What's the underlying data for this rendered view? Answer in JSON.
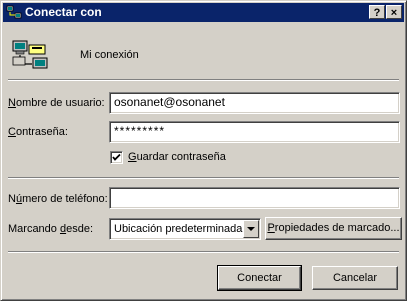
{
  "window": {
    "title": "Conectar con",
    "help_label": "?",
    "close_label": "×"
  },
  "connection": {
    "name": "Mi conexión"
  },
  "form": {
    "username": {
      "label_before": "",
      "label_access": "N",
      "label_after": "ombre de usuario:",
      "value": "osonanet@osonanet"
    },
    "password": {
      "label_before": "",
      "label_access": "C",
      "label_after": "ontraseña:",
      "value": "*********"
    },
    "save_password": {
      "label_before": "",
      "label_access": "G",
      "label_after": "uardar contraseña",
      "checked": true
    },
    "phone": {
      "label_before": "N",
      "label_access": "ú",
      "label_after": "mero de teléfono:",
      "value": ""
    },
    "dialing_from": {
      "label_before": "Marcando ",
      "label_access": "d",
      "label_after": "esde:",
      "selected": "Ubicación predeterminada"
    },
    "dialing_properties": {
      "label_before": "",
      "label_access": "P",
      "label_after": "ropiedades de marcado..."
    }
  },
  "buttons": {
    "connect": "Conectar",
    "cancel": "Cancelar"
  }
}
